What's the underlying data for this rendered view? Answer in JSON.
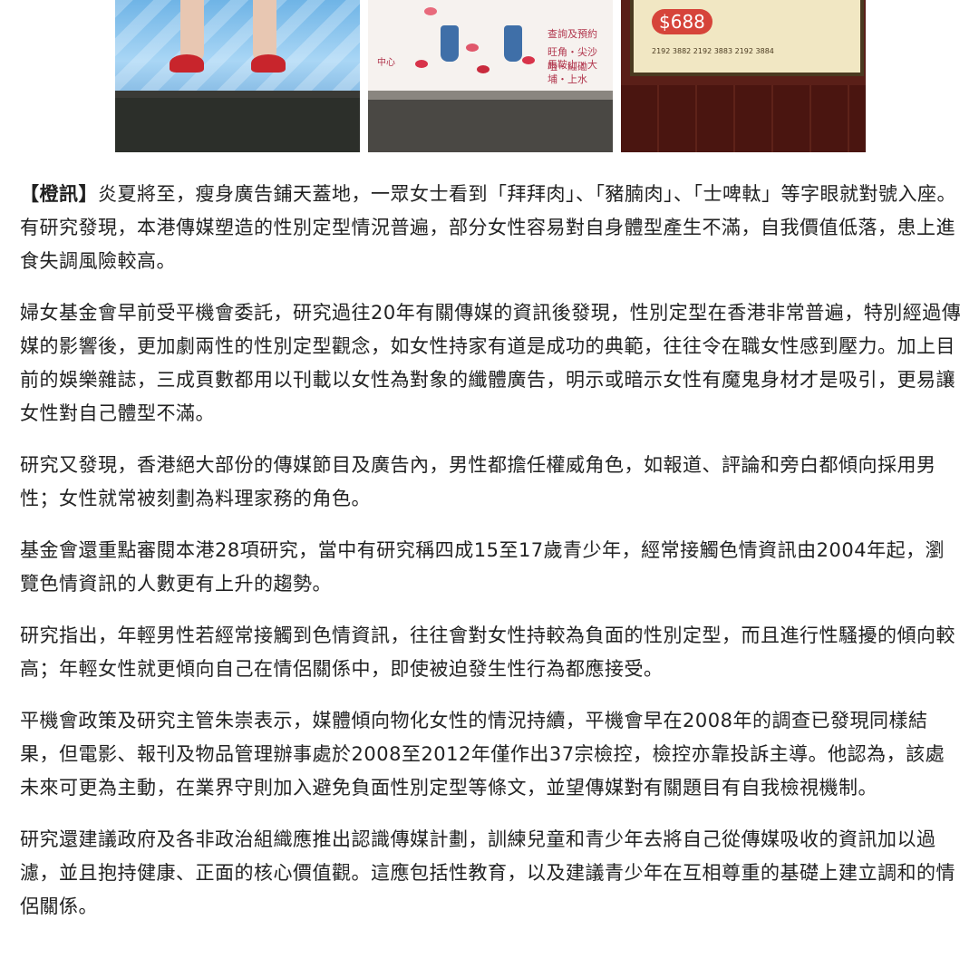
{
  "photos": {
    "photo2_side_text": "中心",
    "photo2_ad_line1": "查詢及預約",
    "photo2_ad_line2": "旺角・尖沙咀・紅磡",
    "photo2_ad_line3": "馬鞍山・大埔・上水",
    "photo3_price": "$688",
    "photo3_phones": "2192 3882   2192 3883   2192 3884"
  },
  "article": {
    "source_tag": "【橙訊】",
    "paragraph_1_body": "炎夏將至，瘦身廣告鋪天蓋地，一眾女士看到「拜拜肉」、「豬腩肉」、「士啤軚」等字眼就對號入座。有研究發現，本港傳媒塑造的性別定型情況普遍，部分女性容易對自身體型產生不滿，自我價值低落，患上進食失調風險較高。",
    "paragraph_2": "婦女基金會早前受平機會委託，研究過往20年有關傳媒的資訊後發現，性別定型在香港非常普遍，特別經過傳媒的影響後，更加劇兩性的性別定型觀念，如女性持家有道是成功的典範，往往令在職女性感到壓力。加上目前的娛樂雜誌，三成頁數都用以刊載以女性為對象的纖體廣告，明示或暗示女性有魔鬼身材才是吸引，更易讓女性對自己體型不滿。",
    "paragraph_3": "研究又發現，香港絕大部份的傳媒節目及廣告內，男性都擔任權威角色，如報道、評論和旁白都傾向採用男性；女性就常被刻劃為料理家務的角色。",
    "paragraph_4": "基金會還重點審閱本港28項研究，當中有研究稱四成15至17歲青少年，經常接觸色情資訊由2004年起，瀏覽色情資訊的人數更有上升的趨勢。",
    "paragraph_5": "研究指出，年輕男性若經常接觸到色情資訊，往往會對女性持較為負面的性別定型，而且進行性騷擾的傾向較高；年輕女性就更傾向自己在情侶關係中，即使被迫發生性行為都應接受。",
    "paragraph_6": "平機會政策及研究主管朱崇表示，媒體傾向物化女性的情況持續，平機會早在2008年的調查已發現同樣結果，但電影、報刊及物品管理辦事處於2008至2012年僅作出37宗檢控，檢控亦靠投訴主導。他認為，該處未來可更為主動，在業界守則加入避免負面性別定型等條文，並望傳媒對有關題目有自我檢視機制。",
    "paragraph_7": "研究還建議政府及各非政治組織應推出認識傳媒計劃，訓練兒童和青少年去將自己從傳媒吸收的資訊加以過濾，並且抱持健康、正面的核心價值觀。這應包括性教育，以及建議青少年在互相尊重的基礎上建立調和的情侶關係。"
  }
}
